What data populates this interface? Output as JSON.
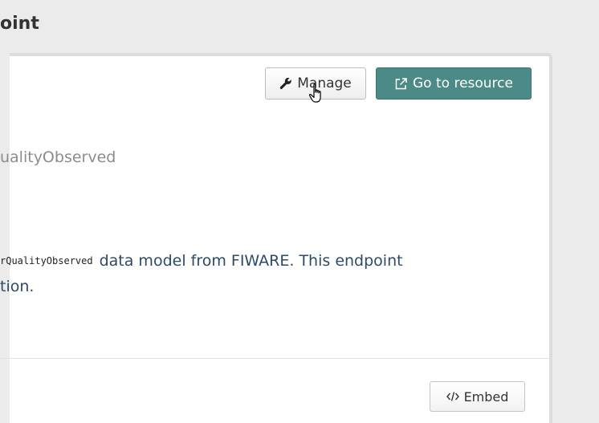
{
  "page": {
    "heading": "oint"
  },
  "toolbar": {
    "manage_label": "Manage",
    "resource_label": "Go to resource"
  },
  "content": {
    "subtitle": "ualityObserved",
    "code_text": "rQualityObserved",
    "description_line1": "data model from FIWARE. This endpoint",
    "description_line2": "tion."
  },
  "footer": {
    "embed_label": "Embed"
  },
  "icons": {
    "manage": "wrench-icon",
    "resource": "external-link-icon",
    "embed": "code-icon",
    "cursor": "hand-pointer-cursor"
  },
  "colors": {
    "accent": "#4b8a86",
    "background": "#ebebeb",
    "text_link": "#2d4a66"
  }
}
